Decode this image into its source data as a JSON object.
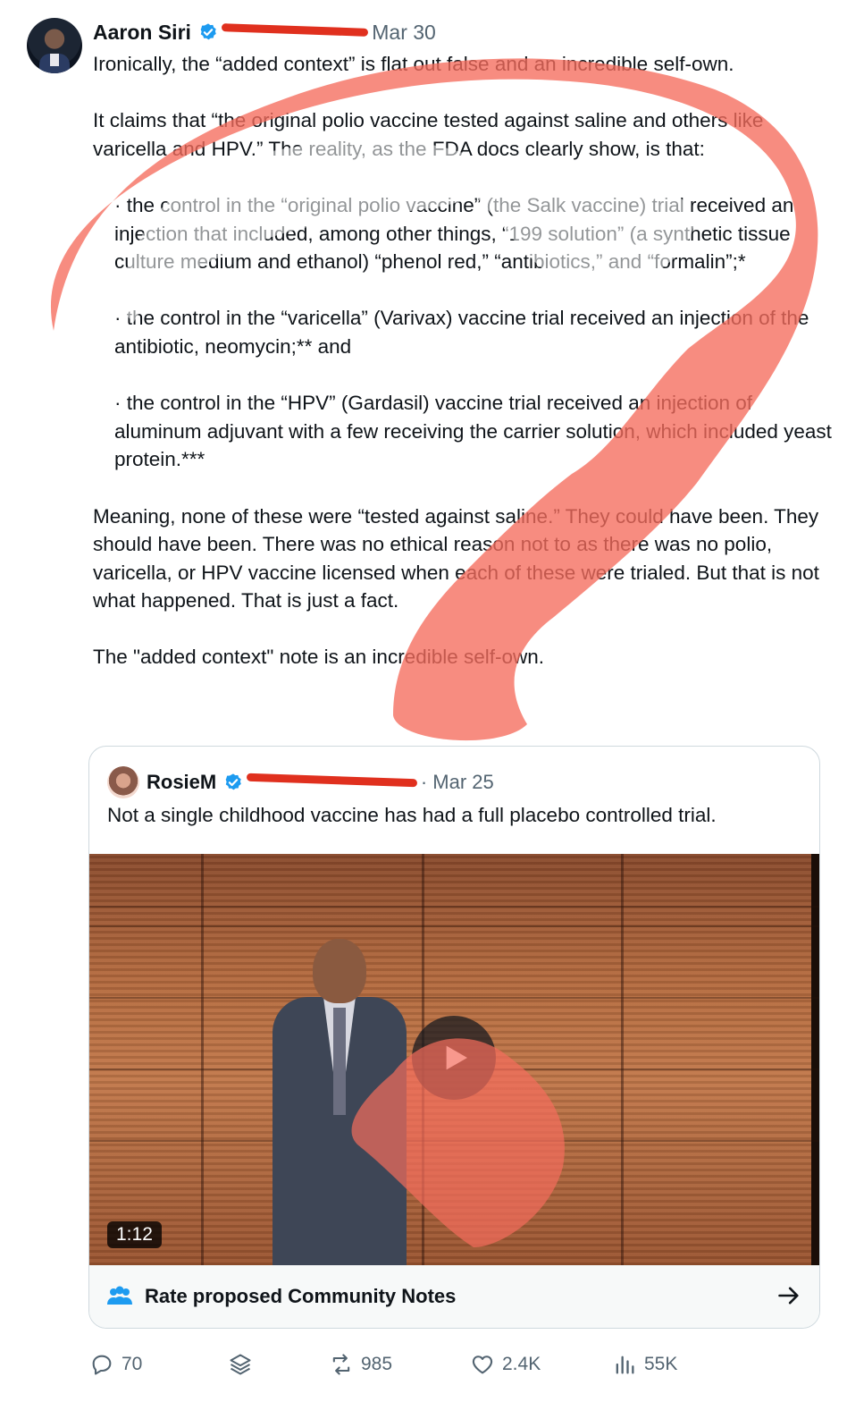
{
  "tweet": {
    "author_name": "Aaron Siri",
    "date": "Mar 30",
    "paragraphs": [
      "Ironically, the “added context” is flat out false and an incredible self-own.",
      "It claims that “the original polio vaccine tested against saline and others like varicella and HPV.” The reality, as the FDA docs clearly show, is that:",
      "· the control in the “original polio vaccine” (the Salk vaccine) trial received an injection that included, among other things, “199 solution” (a synthetic tissue culture medium and ethanol) “phenol red,” “antibiotics,” and “formalin”;*",
      "· the control in the “varicella” (Varivax) vaccine trial received an injection of the antibiotic, neomycin;** and",
      "· the control in the “HPV” (Gardasil) vaccine trial received an injection of aluminum adjuvant with a few receiving the carrier solution, which included yeast protein.***",
      "Meaning, none of these were “tested against saline.” They could have been. They should have been. There was no ethical reason not to as there was no polio, varicella, or HPV vaccine licensed when each of these were trialed. But that is not what happened. That is just a fact.",
      "The \"added context\" note is an incredible self-own."
    ]
  },
  "quoted": {
    "author_name": "RosieM",
    "date": "· Mar 25",
    "text": "Not a single childhood vaccine has had a full placebo controlled trial.",
    "video_duration": "1:12",
    "community_notes_label": "Rate proposed Community Notes"
  },
  "actions": {
    "replies": "70",
    "reposts": "985",
    "likes": "2.4K",
    "views": "55K"
  },
  "colors": {
    "verified": "#1d9bf0",
    "scribble": "#f56c5c",
    "redaction": "#e0301e",
    "secondary_text": "#536471"
  },
  "icons": [
    "verified-badge-icon",
    "reply-icon",
    "bookmark-layers-icon",
    "repost-icon",
    "like-icon",
    "views-icon",
    "play-icon",
    "community-notes-icon",
    "arrow-right-icon"
  ]
}
